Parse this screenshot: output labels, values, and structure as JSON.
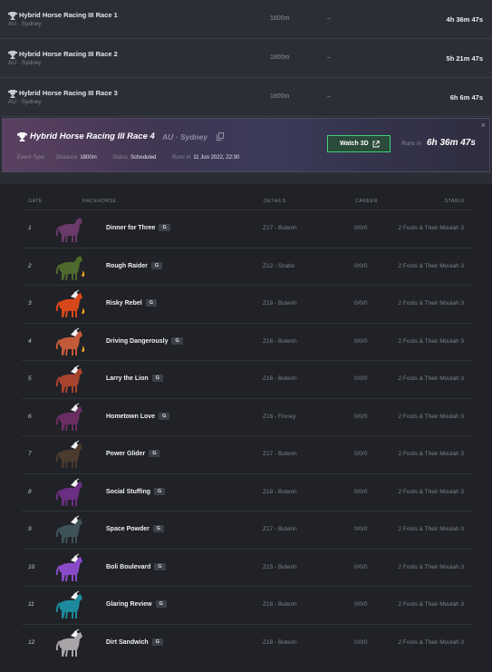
{
  "races": [
    {
      "name": "Hybrid Horse Racing III Race 1",
      "location": "AU · Sydney",
      "distance": "1800m",
      "prize": "–",
      "time": "4h 36m 47s"
    },
    {
      "name": "Hybrid Horse Racing III Race 2",
      "location": "AU · Sydney",
      "distance": "1800m",
      "prize": "–",
      "time": "5h 21m 47s"
    },
    {
      "name": "Hybrid Horse Racing III Race 3",
      "location": "AU · Sydney",
      "distance": "1800m",
      "prize": "–",
      "time": "6h 6m 47s"
    }
  ],
  "selected_race": {
    "title": "Hybrid Horse Racing III Race 4",
    "location": "AU · Sydney",
    "meta": [
      {
        "key": "Event Type",
        "value": ""
      },
      {
        "key": "Distance",
        "value": "1800m"
      },
      {
        "key": "Status",
        "value": "Scheduled"
      },
      {
        "key": "Runs in",
        "value": "11 Jun 2022, 22:30"
      }
    ],
    "watch_label": "Watch 3D",
    "runs_label": "Runs in",
    "runs_time": "6h 36m 47s",
    "close_glyph": "×"
  },
  "table": {
    "headers": {
      "gate": "GATE",
      "racehorse": "RACEHORSE",
      "details": "DETAILS",
      "career": "CAREER",
      "stable": "STABLE"
    },
    "rows": [
      {
        "gate": "1",
        "name": "Dinner for Three",
        "badge": "G",
        "details": "Z17 - Buterin",
        "career": "0/0/0",
        "stable": "2 Fools & Their Moulah 3",
        "color": "#6a3a6a",
        "mane": false,
        "flame": false
      },
      {
        "gate": "2",
        "name": "Rough Raider",
        "badge": "G",
        "details": "Z12 - Szabo",
        "career": "0/0/0",
        "stable": "2 Fools & Their Moulah 3",
        "color": "#4e6a2c",
        "mane": false,
        "flame": true
      },
      {
        "gate": "3",
        "name": "Risky Rebel",
        "badge": "G",
        "details": "Z18 - Buterin",
        "career": "0/0/0",
        "stable": "2 Fools & Their Moulah 3",
        "color": "#d8481a",
        "mane": true,
        "flame": true
      },
      {
        "gate": "4",
        "name": "Driving Dangerously",
        "badge": "G",
        "details": "Z16 - Buterin",
        "career": "0/0/0",
        "stable": "2 Fools & Their Moulah 3",
        "color": "#c35a3a",
        "mane": true,
        "flame": true
      },
      {
        "gate": "5",
        "name": "Larry the Lion",
        "badge": "G",
        "details": "Z16 - Buterin",
        "career": "0/0/0",
        "stable": "2 Fools & Their Moulah 3",
        "color": "#a8432e",
        "mane": true,
        "flame": false
      },
      {
        "gate": "6",
        "name": "Hometown Love",
        "badge": "G",
        "details": "Z16 - Finney",
        "career": "0/0/0",
        "stable": "2 Fools & Their Moulah 3",
        "color": "#6a2e62",
        "mane": true,
        "flame": false
      },
      {
        "gate": "7",
        "name": "Power Glider",
        "badge": "G",
        "details": "Z17 - Buterin",
        "career": "0/0/0",
        "stable": "2 Fools & Their Moulah 3",
        "color": "#4a3b2e",
        "mane": true,
        "flame": false
      },
      {
        "gate": "8",
        "name": "Social Stuffing",
        "badge": "G",
        "details": "Z18 - Buterin",
        "career": "0/0/0",
        "stable": "2 Fools & Their Moulah 3",
        "color": "#6a2e82",
        "mane": true,
        "flame": false
      },
      {
        "gate": "9",
        "name": "Space Powder",
        "badge": "G",
        "details": "Z17 - Buterin",
        "career": "0/0/0",
        "stable": "2 Fools & Their Moulah 3",
        "color": "#3e5258",
        "mane": true,
        "flame": false
      },
      {
        "gate": "10",
        "name": "Boli Boulevard",
        "badge": "G",
        "details": "Z15 - Buterin",
        "career": "0/0/0",
        "stable": "2 Fools & Their Moulah 3",
        "color": "#8a4ac8",
        "mane": true,
        "flame": false
      },
      {
        "gate": "11",
        "name": "Glaring Review",
        "badge": "G",
        "details": "Z18 - Buterin",
        "career": "0/0/0",
        "stable": "2 Fools & Their Moulah 3",
        "color": "#1c8a9c",
        "mane": true,
        "flame": false
      },
      {
        "gate": "12",
        "name": "Dirt Sandwich",
        "badge": "G",
        "details": "Z18 - Buterin",
        "career": "0/0/0",
        "stable": "2 Fools & Their Moulah 3",
        "color": "#a8a4a8",
        "mane": true,
        "flame": false
      }
    ]
  }
}
